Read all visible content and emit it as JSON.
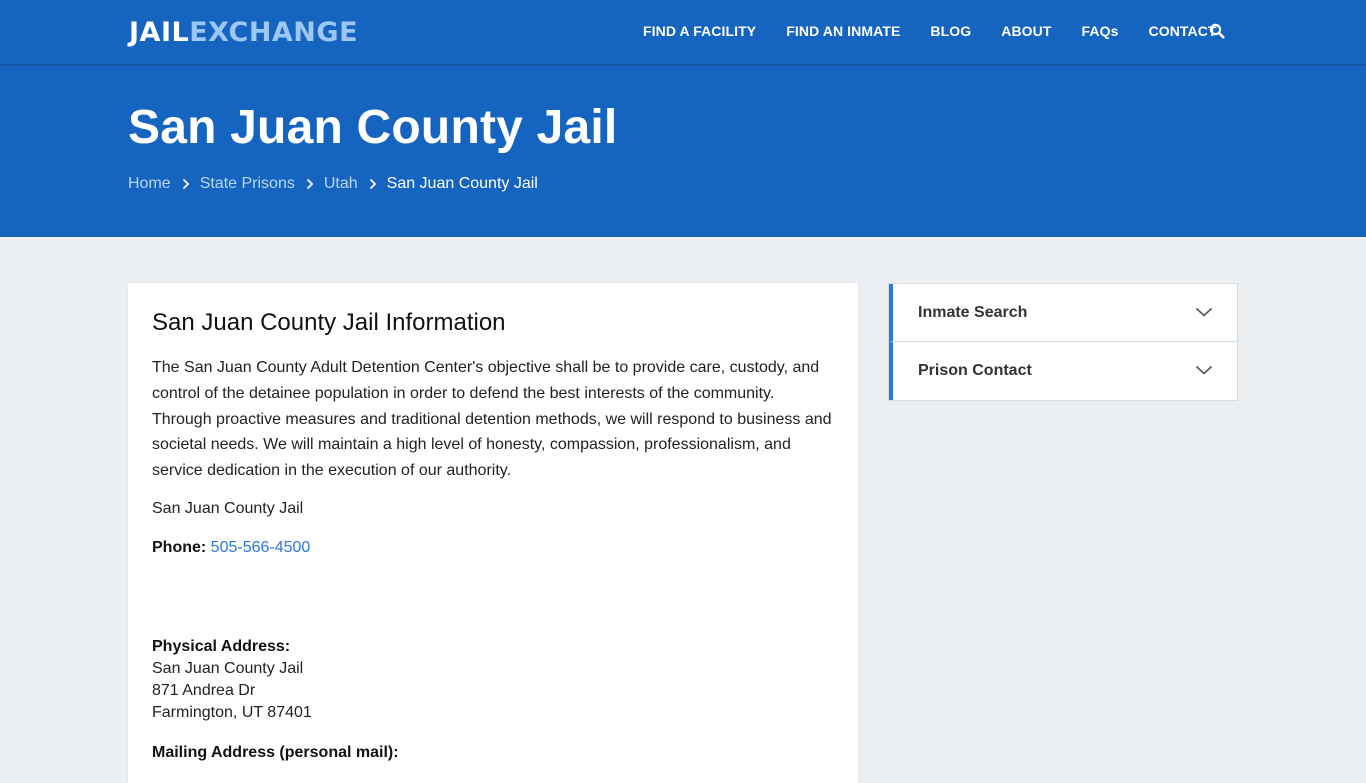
{
  "header": {
    "logo_part1": "JAIL",
    "logo_part2": "EXCHANGE",
    "nav": [
      "FIND A FACILITY",
      "FIND AN INMATE",
      "BLOG",
      "ABOUT",
      "FAQs",
      "CONTACT"
    ],
    "search_icon": "search-icon"
  },
  "hero": {
    "title": "San Juan County Jail",
    "breadcrumb": [
      "Home",
      "State Prisons",
      "Utah",
      "San Juan County Jail"
    ]
  },
  "main": {
    "heading": "San Juan County Jail Information",
    "description": "The San Juan County Adult Detention Center's objective shall be to provide care, custody, and control of the detainee population in order to defend the best interests of the community. Through proactive measures and traditional detention methods, we will respond to business and societal needs. We will maintain a high level of honesty, compassion, professionalism, and service dedication in the execution of our authority.",
    "facility_name": "San Juan County Jail",
    "phone_label": "Phone:",
    "phone": "505-566-4500",
    "physical_address_label": "Physical Address:",
    "physical_address": [
      "San Juan County Jail",
      "871 Andrea Dr",
      "Farmington, UT 87401"
    ],
    "mailing_address_label": "Mailing Address (personal mail):"
  },
  "sidebar": {
    "items": [
      "Inmate Search",
      "Prison Contact"
    ]
  },
  "colors": {
    "primary": "#1565c0",
    "logo_accent": "#9cc6f3",
    "link": "#2a7ad8",
    "background": "#ebeff2"
  }
}
